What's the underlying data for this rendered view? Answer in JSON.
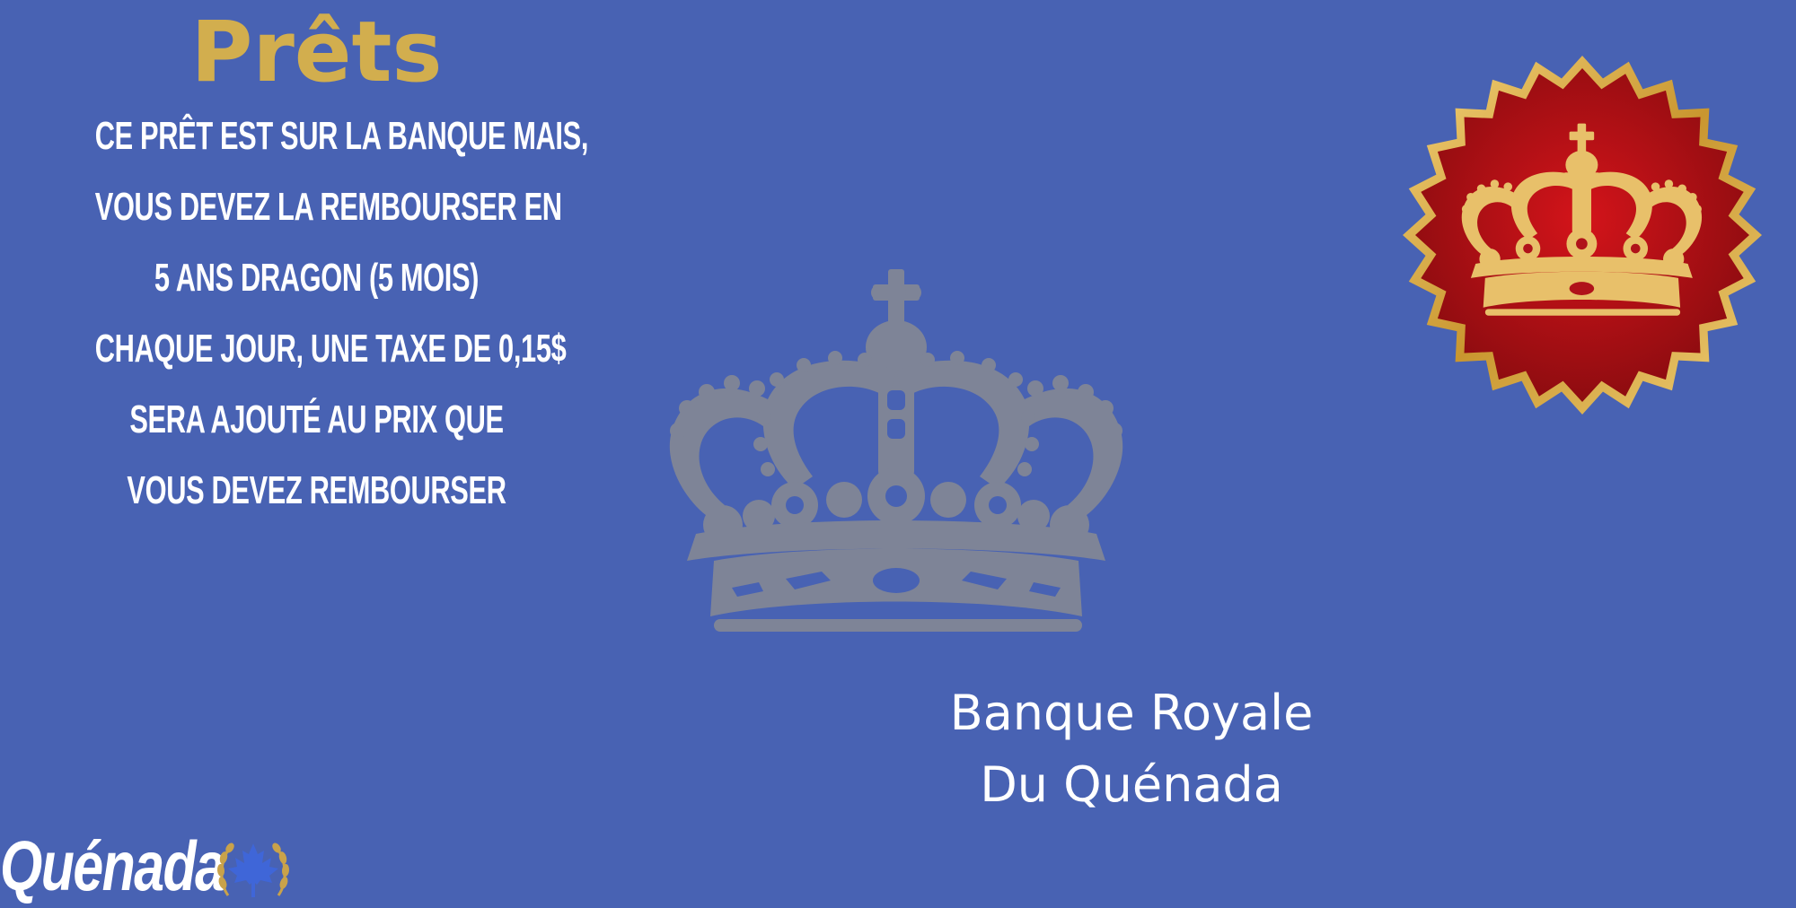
{
  "title": "Prêts",
  "description": [
    "CE PRÊT EST SUR LA BANQUE MAIS,",
    "VOUS DEVEZ LA REMBOURSER EN",
    "5 ANS DRAGON (5 MOIS)",
    "CHAQUE JOUR, UNE TAXE DE 0,15$",
    "SERA AJOUTÉ AU PRIX QUE",
    "VOUS DEVEZ REMBOURSER"
  ],
  "bank": {
    "line1": "Banque Royale",
    "line2": "Du Quénada"
  },
  "brand": {
    "name": "Quénada"
  },
  "icons": {
    "center": "crown-icon",
    "badge": "crown-seal-icon",
    "brand": "maple-leaf-laurel-icon"
  },
  "colors": {
    "background": "#4862b3",
    "gold": "#d2ae4e",
    "crown_gray": "#7e8497",
    "badge_red": "#b0121a"
  }
}
